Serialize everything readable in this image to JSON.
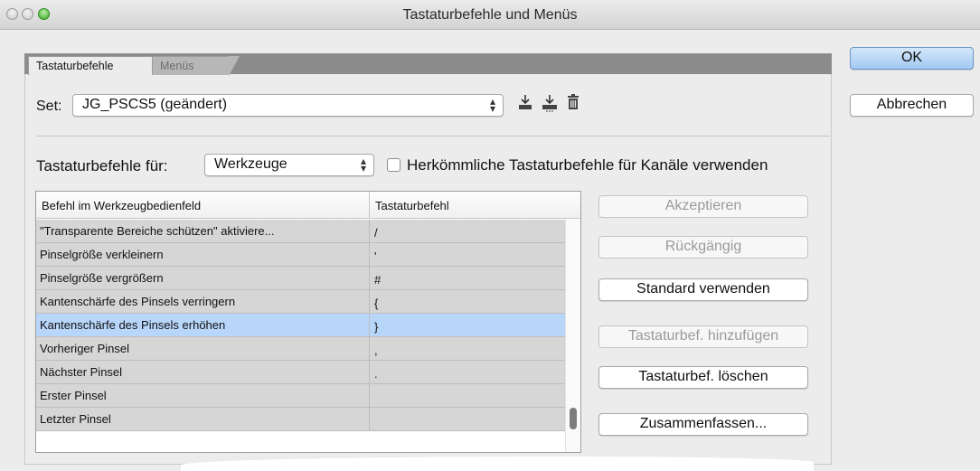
{
  "window": {
    "title": "Tastaturbefehle und Menüs"
  },
  "tabs": [
    {
      "label": "Tastaturbefehle",
      "active": true
    },
    {
      "label": "Menüs",
      "active": false
    }
  ],
  "set": {
    "label": "Set:",
    "value": "JG_PSCS5 (geändert)"
  },
  "set_icons": [
    "save-set-icon",
    "save-set-as-icon",
    "delete-set-icon"
  ],
  "shortcuts_for": {
    "label": "Tastaturbefehle für:",
    "value": "Werkzeuge"
  },
  "legacy_checkbox": {
    "label": "Herkömmliche Tastaturbefehle für Kanäle verwenden",
    "checked": false
  },
  "table": {
    "headers": [
      "Befehl im Werkzeugbedienfeld",
      "Tastaturbefehl"
    ],
    "rows": [
      {
        "command": "\"Transparente Bereiche schützen\" aktiviere...",
        "shortcut": "/"
      },
      {
        "command": "Pinselgröße verkleinern",
        "shortcut": "'"
      },
      {
        "command": "Pinselgröße vergrößern",
        "shortcut": "#"
      },
      {
        "command": "Kantenschärfe des Pinsels verringern",
        "shortcut": "{"
      },
      {
        "command": "Kantenschärfe des Pinsels erhöhen",
        "shortcut": "}",
        "selected": true
      },
      {
        "command": "Vorheriger Pinsel",
        "shortcut": ","
      },
      {
        "command": "Nächster Pinsel",
        "shortcut": "."
      },
      {
        "command": "Erster Pinsel",
        "shortcut": ""
      },
      {
        "command": "Letzter Pinsel",
        "shortcut": ""
      }
    ]
  },
  "buttons": {
    "ok": "OK",
    "cancel": "Abbrechen",
    "accept": "Akzeptieren",
    "undo": "Rückgängig",
    "use_default": "Standard verwenden",
    "add_shortcut": "Tastaturbef. hinzufügen",
    "delete_shortcut": "Tastaturbef. löschen",
    "summarize": "Zusammenfassen..."
  },
  "colors": {
    "selected_row": "#b8d5fa",
    "default_button": "#a2c9f3"
  }
}
